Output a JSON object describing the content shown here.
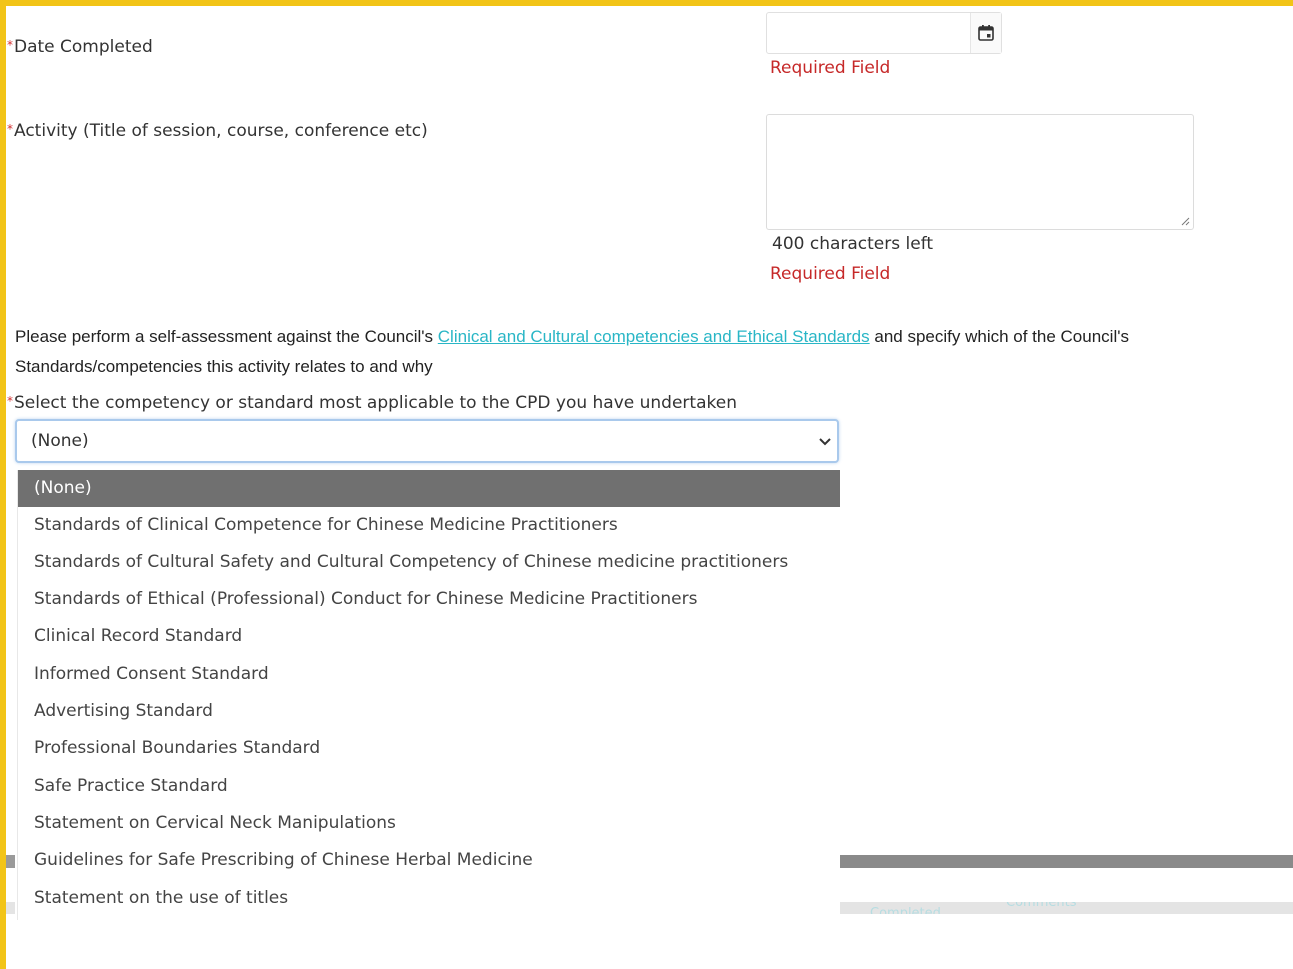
{
  "form": {
    "date_completed": {
      "label": "Date Completed",
      "value": "",
      "error": "Required Field",
      "icon": "calendar-icon"
    },
    "activity": {
      "label": "Activity (Title of session, course, conference etc)",
      "value": "",
      "char_count": "400 characters left",
      "error": "Required Field"
    },
    "self_assessment": {
      "text_before": "Please perform a self-assessment against the Council's ",
      "link_text": "Clinical and Cultural competencies and Ethical Standards",
      "text_after": " and specify which of the Council's Standards/competencies this activity relates to and why"
    },
    "competency": {
      "label": "Select the competency or standard most applicable to the CPD you have undertaken",
      "selected": "(None)",
      "options": [
        "(None)",
        "Standards of Clinical Competence for Chinese Medicine Practitioners",
        "Standards of Cultural Safety and Cultural Competency of Chinese medicine practitioners",
        "Standards of Ethical (Professional) Conduct for Chinese Medicine Practitioners",
        "Clinical Record Standard",
        "Informed Consent Standard",
        "Advertising Standard",
        "Professional Boundaries Standard",
        "Safe Practice Standard",
        "Statement on Cervical Neck Manipulations",
        "Guidelines for Safe Prescribing of Chinese Herbal Medicine",
        "Statement on the use of titles"
      ]
    }
  },
  "background": {
    "faded_labels": [
      "Completed",
      "Comments"
    ]
  },
  "colors": {
    "frame": "#f2c417",
    "error": "#c62828",
    "required_marker": "#d32f2f",
    "link": "#29b6c6",
    "selected_option_bg": "#707070",
    "focus_border": "#a9c9ec"
  }
}
